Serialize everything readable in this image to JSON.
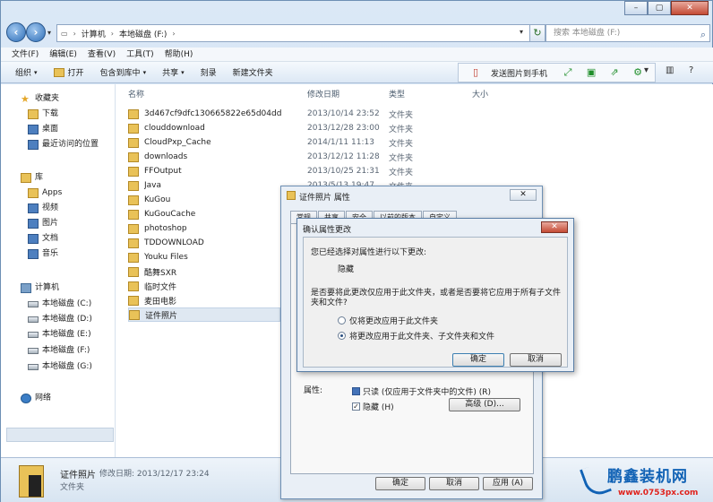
{
  "window": {
    "caption_buttons": [
      "–",
      "▢",
      "✕"
    ]
  },
  "nav": {
    "address": [
      "计算机",
      "本地磁盘 (F:)"
    ],
    "search_placeholder": "搜索 本地磁盘 (F:)"
  },
  "menu": [
    "文件(F)",
    "编辑(E)",
    "查看(V)",
    "工具(T)",
    "帮助(H)"
  ],
  "toolbar": {
    "organize": "组织",
    "open": "打开",
    "include": "包含到库中",
    "share": "共享",
    "burn": "刻录",
    "new_folder": "新建文件夹",
    "send_to_phone": "发送图片到手机"
  },
  "sidebar": {
    "favorites": "收藏夹",
    "fav_items": [
      "下载",
      "桌面",
      "最近访问的位置"
    ],
    "library": "库",
    "lib_items": [
      "Apps",
      "视频",
      "图片",
      "文档",
      "音乐"
    ],
    "computer": "计算机",
    "drives": [
      "本地磁盘 (C:)",
      "本地磁盘 (D:)",
      "本地磁盘 (E:)",
      "本地磁盘 (F:)",
      "本地磁盘 (G:)"
    ],
    "network": "网络"
  },
  "columns": {
    "name": "名称",
    "date": "修改日期",
    "type": "类型",
    "size": "大小"
  },
  "files": [
    {
      "name": "3d467cf9dfc130665822e65d04dd",
      "date": "2013/10/14 23:52",
      "type": "文件夹"
    },
    {
      "name": "clouddownload",
      "date": "2013/12/28 23:00",
      "type": "文件夹"
    },
    {
      "name": "CloudPxp_Cache",
      "date": "2014/1/11 11:13",
      "type": "文件夹"
    },
    {
      "name": "downloads",
      "date": "2013/12/12 11:28",
      "type": "文件夹"
    },
    {
      "name": "FFOutput",
      "date": "2013/10/25 21:31",
      "type": "文件夹"
    },
    {
      "name": "Java",
      "date": "2013/5/13 19:47",
      "type": "文件夹"
    },
    {
      "name": "KuGou",
      "date": "",
      "type": ""
    },
    {
      "name": "KuGouCache",
      "date": "",
      "type": ""
    },
    {
      "name": "photoshop",
      "date": "",
      "type": ""
    },
    {
      "name": "TDDOWNLOAD",
      "date": "",
      "type": ""
    },
    {
      "name": "Youku Files",
      "date": "",
      "type": ""
    },
    {
      "name": "酷舞SXR",
      "date": "",
      "type": ""
    },
    {
      "name": "临时文件",
      "date": "",
      "type": ""
    },
    {
      "name": "麦田电影",
      "date": "",
      "type": ""
    },
    {
      "name": "证件照片",
      "date": "",
      "type": ""
    }
  ],
  "details": {
    "name": "证件照片",
    "date_label": "修改日期: 2013/12/17 23:24",
    "type": "文件夹"
  },
  "properties_dialog": {
    "title": "证件照片 属性",
    "close": "✕",
    "tabs": [
      "常规",
      "共享",
      "安全",
      "以前的版本",
      "自定义"
    ],
    "attr_label": "属性:",
    "readonly": "只读 (仅应用于文件夹中的文件) (R)",
    "hidden": "隐藏 (H)",
    "advanced": "高级 (D)...",
    "ok": "确定",
    "cancel": "取消",
    "apply": "应用 (A)"
  },
  "confirm_dialog": {
    "title": "确认属性更改",
    "close": "✕",
    "line1": "您已经选择对属性进行以下更改:",
    "change": "隐藏",
    "question": "是否要将此更改仅应用于此文件夹，或者是否要将它应用于所有子文件夹和文件?",
    "option1": "仅将更改应用于此文件夹",
    "option2": "将更改应用于此文件夹、子文件夹和文件",
    "ok": "确定",
    "cancel": "取消"
  },
  "watermark": {
    "brand": "鹏鑫装机网",
    "url": "www.0753px.com"
  }
}
